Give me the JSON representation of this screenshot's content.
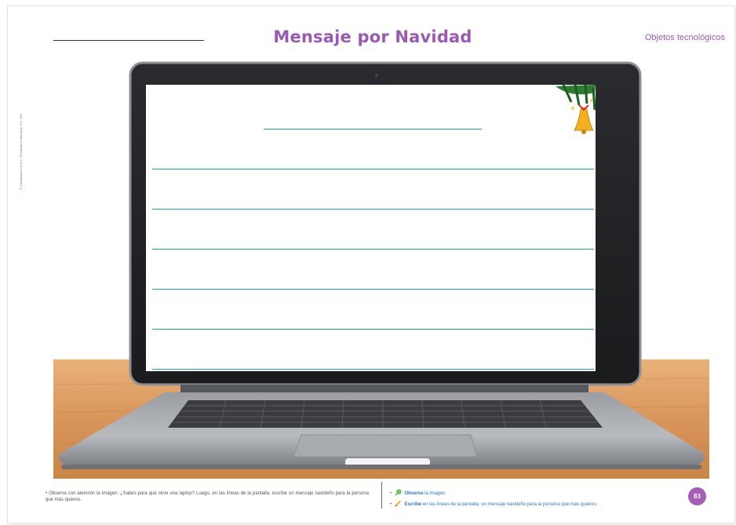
{
  "header": {
    "title": "Mensaje por Navidad",
    "topic": "Objetos tecnológicos"
  },
  "copyright": "© Coordinación S.A.C. Prohibida la fotocopia. D.L. 822",
  "footer": {
    "instruction": "• Observa con atención la imagen. ¿Sabes para qué sirve una laptop? Luego, en las líneas de la pantalla, escribe un mensaje navideño para la persona que más quieres.",
    "steps": [
      {
        "icon": "magnifier-icon",
        "bold": "Observa",
        "text": " la imagen."
      },
      {
        "icon": "pencil-icon",
        "bold": "Escribe",
        "text": " en las líneas de la pantalla, un mensaje navideño para la persona que más quieres."
      }
    ],
    "page_number": "83"
  },
  "colors": {
    "title": "#9b59b6",
    "writing_lines": "#1aa89a",
    "page_badge": "#a55cb8",
    "step_text": "#2a79c0"
  }
}
